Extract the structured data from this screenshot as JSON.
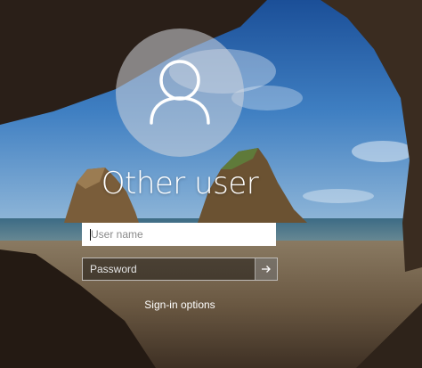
{
  "login": {
    "username_heading": "Other user",
    "username_placeholder": "User name",
    "password_placeholder": "Password",
    "sign_in_options": "Sign-in options"
  },
  "icons": {
    "avatar": "person-icon",
    "submit": "arrow-right-icon"
  }
}
